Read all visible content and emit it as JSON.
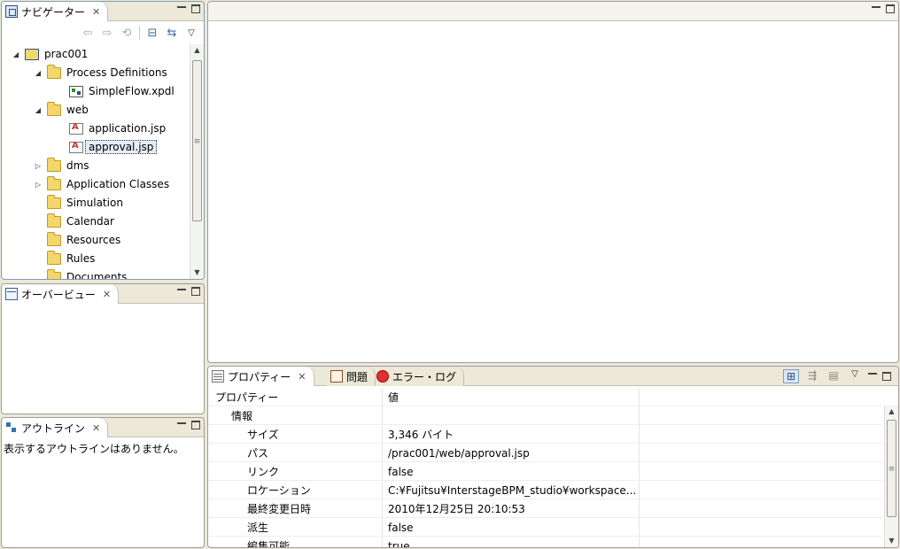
{
  "navigator": {
    "tab_label": "ナビゲーター",
    "tree": [
      {
        "label": "prac001",
        "level": 0,
        "icon": "project",
        "twisty": "open"
      },
      {
        "label": "Process Definitions",
        "level": 1,
        "icon": "folder",
        "twisty": "open"
      },
      {
        "label": "SimpleFlow.xpdl",
        "level": 2,
        "icon": "xpdl",
        "twisty": ""
      },
      {
        "label": "web",
        "level": 1,
        "icon": "folder",
        "twisty": "open"
      },
      {
        "label": "application.jsp",
        "level": 2,
        "icon": "jsp",
        "twisty": ""
      },
      {
        "label": "approval.jsp",
        "level": 2,
        "icon": "jsp",
        "twisty": "",
        "selected": true
      },
      {
        "label": "dms",
        "level": 1,
        "icon": "folder",
        "twisty": "closed"
      },
      {
        "label": "Application Classes",
        "level": 1,
        "icon": "folder",
        "twisty": "closed"
      },
      {
        "label": "Simulation",
        "level": 1,
        "icon": "folder",
        "twisty": ""
      },
      {
        "label": "Calendar",
        "level": 1,
        "icon": "folder",
        "twisty": ""
      },
      {
        "label": "Resources",
        "level": 1,
        "icon": "folder",
        "twisty": ""
      },
      {
        "label": "Rules",
        "level": 1,
        "icon": "folder",
        "twisty": ""
      },
      {
        "label": "Documents",
        "level": 1,
        "icon": "folder",
        "twisty": ""
      }
    ]
  },
  "overview": {
    "tab_label": "オーバービュー"
  },
  "outline": {
    "tab_label": "アウトライン",
    "message": "表示するアウトラインはありません。"
  },
  "properties": {
    "tabs": [
      "プロパティー",
      "問題",
      "エラー・ログ"
    ],
    "columns": [
      "プロパティー",
      "値"
    ],
    "rows": [
      {
        "key": "情報",
        "value": "",
        "indent": 1
      },
      {
        "key": "サイズ",
        "value": "3,346 バイト",
        "indent": 2
      },
      {
        "key": "パス",
        "value": "/prac001/web/approval.jsp",
        "indent": 2
      },
      {
        "key": "リンク",
        "value": "false",
        "indent": 2
      },
      {
        "key": "ロケーション",
        "value": "C:¥Fujitsu¥InterstageBPM_studio¥workspace...",
        "indent": 2
      },
      {
        "key": "最終変更日時",
        "value": "2010年12月25日 20:10:53",
        "indent": 2
      },
      {
        "key": "派生",
        "value": "false",
        "indent": 2
      },
      {
        "key": "編集可能",
        "value": "true",
        "indent": 2
      }
    ]
  }
}
